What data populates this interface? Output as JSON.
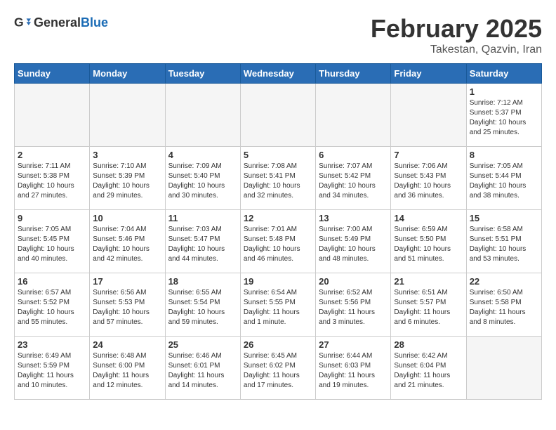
{
  "logo": {
    "general": "General",
    "blue": "Blue"
  },
  "calendar": {
    "title": "February 2025",
    "subtitle": "Takestan, Qazvin, Iran"
  },
  "headers": [
    "Sunday",
    "Monday",
    "Tuesday",
    "Wednesday",
    "Thursday",
    "Friday",
    "Saturday"
  ],
  "weeks": [
    [
      {
        "day": "",
        "info": ""
      },
      {
        "day": "",
        "info": ""
      },
      {
        "day": "",
        "info": ""
      },
      {
        "day": "",
        "info": ""
      },
      {
        "day": "",
        "info": ""
      },
      {
        "day": "",
        "info": ""
      },
      {
        "day": "1",
        "info": "Sunrise: 7:12 AM\nSunset: 5:37 PM\nDaylight: 10 hours\nand 25 minutes."
      }
    ],
    [
      {
        "day": "2",
        "info": "Sunrise: 7:11 AM\nSunset: 5:38 PM\nDaylight: 10 hours\nand 27 minutes."
      },
      {
        "day": "3",
        "info": "Sunrise: 7:10 AM\nSunset: 5:39 PM\nDaylight: 10 hours\nand 29 minutes."
      },
      {
        "day": "4",
        "info": "Sunrise: 7:09 AM\nSunset: 5:40 PM\nDaylight: 10 hours\nand 30 minutes."
      },
      {
        "day": "5",
        "info": "Sunrise: 7:08 AM\nSunset: 5:41 PM\nDaylight: 10 hours\nand 32 minutes."
      },
      {
        "day": "6",
        "info": "Sunrise: 7:07 AM\nSunset: 5:42 PM\nDaylight: 10 hours\nand 34 minutes."
      },
      {
        "day": "7",
        "info": "Sunrise: 7:06 AM\nSunset: 5:43 PM\nDaylight: 10 hours\nand 36 minutes."
      },
      {
        "day": "8",
        "info": "Sunrise: 7:05 AM\nSunset: 5:44 PM\nDaylight: 10 hours\nand 38 minutes."
      }
    ],
    [
      {
        "day": "9",
        "info": "Sunrise: 7:05 AM\nSunset: 5:45 PM\nDaylight: 10 hours\nand 40 minutes."
      },
      {
        "day": "10",
        "info": "Sunrise: 7:04 AM\nSunset: 5:46 PM\nDaylight: 10 hours\nand 42 minutes."
      },
      {
        "day": "11",
        "info": "Sunrise: 7:03 AM\nSunset: 5:47 PM\nDaylight: 10 hours\nand 44 minutes."
      },
      {
        "day": "12",
        "info": "Sunrise: 7:01 AM\nSunset: 5:48 PM\nDaylight: 10 hours\nand 46 minutes."
      },
      {
        "day": "13",
        "info": "Sunrise: 7:00 AM\nSunset: 5:49 PM\nDaylight: 10 hours\nand 48 minutes."
      },
      {
        "day": "14",
        "info": "Sunrise: 6:59 AM\nSunset: 5:50 PM\nDaylight: 10 hours\nand 51 minutes."
      },
      {
        "day": "15",
        "info": "Sunrise: 6:58 AM\nSunset: 5:51 PM\nDaylight: 10 hours\nand 53 minutes."
      }
    ],
    [
      {
        "day": "16",
        "info": "Sunrise: 6:57 AM\nSunset: 5:52 PM\nDaylight: 10 hours\nand 55 minutes."
      },
      {
        "day": "17",
        "info": "Sunrise: 6:56 AM\nSunset: 5:53 PM\nDaylight: 10 hours\nand 57 minutes."
      },
      {
        "day": "18",
        "info": "Sunrise: 6:55 AM\nSunset: 5:54 PM\nDaylight: 10 hours\nand 59 minutes."
      },
      {
        "day": "19",
        "info": "Sunrise: 6:54 AM\nSunset: 5:55 PM\nDaylight: 11 hours\nand 1 minute."
      },
      {
        "day": "20",
        "info": "Sunrise: 6:52 AM\nSunset: 5:56 PM\nDaylight: 11 hours\nand 3 minutes."
      },
      {
        "day": "21",
        "info": "Sunrise: 6:51 AM\nSunset: 5:57 PM\nDaylight: 11 hours\nand 6 minutes."
      },
      {
        "day": "22",
        "info": "Sunrise: 6:50 AM\nSunset: 5:58 PM\nDaylight: 11 hours\nand 8 minutes."
      }
    ],
    [
      {
        "day": "23",
        "info": "Sunrise: 6:49 AM\nSunset: 5:59 PM\nDaylight: 11 hours\nand 10 minutes."
      },
      {
        "day": "24",
        "info": "Sunrise: 6:48 AM\nSunset: 6:00 PM\nDaylight: 11 hours\nand 12 minutes."
      },
      {
        "day": "25",
        "info": "Sunrise: 6:46 AM\nSunset: 6:01 PM\nDaylight: 11 hours\nand 14 minutes."
      },
      {
        "day": "26",
        "info": "Sunrise: 6:45 AM\nSunset: 6:02 PM\nDaylight: 11 hours\nand 17 minutes."
      },
      {
        "day": "27",
        "info": "Sunrise: 6:44 AM\nSunset: 6:03 PM\nDaylight: 11 hours\nand 19 minutes."
      },
      {
        "day": "28",
        "info": "Sunrise: 6:42 AM\nSunset: 6:04 PM\nDaylight: 11 hours\nand 21 minutes."
      },
      {
        "day": "",
        "info": ""
      }
    ]
  ]
}
